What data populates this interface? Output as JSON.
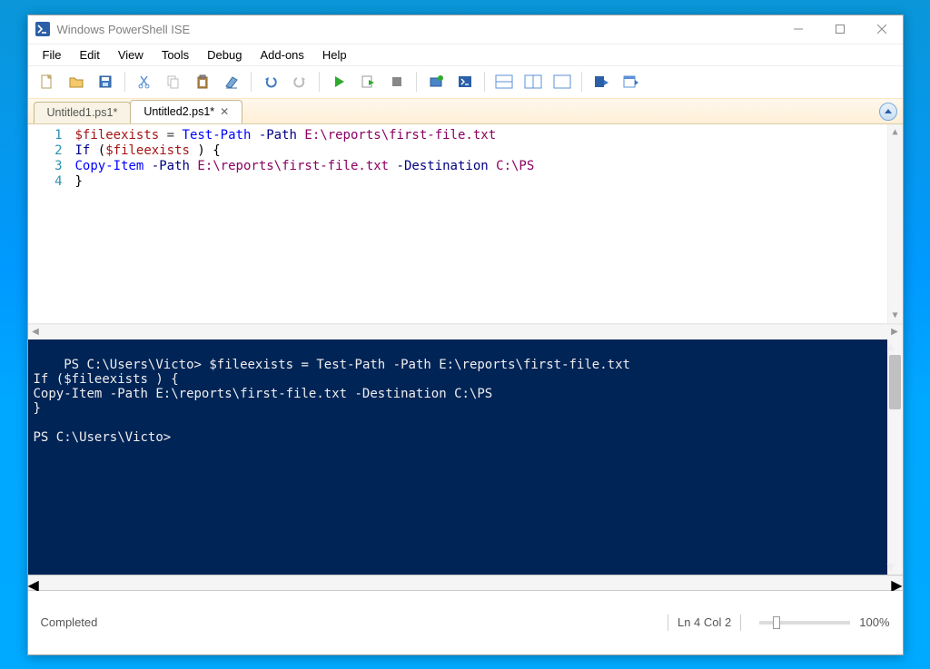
{
  "window": {
    "title": "Windows PowerShell ISE"
  },
  "menu": {
    "file": "File",
    "edit": "Edit",
    "view": "View",
    "tools": "Tools",
    "debug": "Debug",
    "addons": "Add-ons",
    "help": "Help"
  },
  "tabs": [
    {
      "label": "Untitled1.ps1*",
      "active": false
    },
    {
      "label": "Untitled2.ps1*",
      "active": true
    }
  ],
  "editor": {
    "line_numbers": [
      "1",
      "2",
      "3",
      "4"
    ],
    "lines": [
      {
        "segments": [
          {
            "t": "$fileexists",
            "c": "tok-var"
          },
          {
            "t": " = ",
            "c": "tok-op"
          },
          {
            "t": "Test-Path",
            "c": "tok-cmd"
          },
          {
            "t": " ",
            "c": "tok-txt"
          },
          {
            "t": "-Path",
            "c": "tok-param"
          },
          {
            "t": " ",
            "c": "tok-txt"
          },
          {
            "t": "E:\\reports\\first-file.txt",
            "c": "tok-str"
          }
        ]
      },
      {
        "segments": [
          {
            "t": "If",
            "c": "tok-kw"
          },
          {
            "t": " (",
            "c": "tok-txt"
          },
          {
            "t": "$fileexists",
            "c": "tok-var"
          },
          {
            "t": " ) {",
            "c": "tok-txt"
          }
        ]
      },
      {
        "segments": [
          {
            "t": "Copy-Item",
            "c": "tok-cmd"
          },
          {
            "t": " ",
            "c": "tok-txt"
          },
          {
            "t": "-Path",
            "c": "tok-param"
          },
          {
            "t": " ",
            "c": "tok-txt"
          },
          {
            "t": "E:\\reports\\first-file.txt",
            "c": "tok-str"
          },
          {
            "t": " ",
            "c": "tok-txt"
          },
          {
            "t": "-Destination",
            "c": "tok-param"
          },
          {
            "t": " ",
            "c": "tok-txt"
          },
          {
            "t": "C:\\PS",
            "c": "tok-str"
          }
        ]
      },
      {
        "segments": [
          {
            "t": "}",
            "c": "tok-txt"
          }
        ]
      }
    ]
  },
  "console": {
    "text": "PS C:\\Users\\Victo> $fileexists = Test-Path -Path E:\\reports\\first-file.txt\nIf ($fileexists ) {\nCopy-Item -Path E:\\reports\\first-file.txt -Destination C:\\PS\n}\n\nPS C:\\Users\\Victo>"
  },
  "status": {
    "left": "Completed",
    "cursor": "Ln 4  Col 2",
    "zoom": "100%"
  }
}
